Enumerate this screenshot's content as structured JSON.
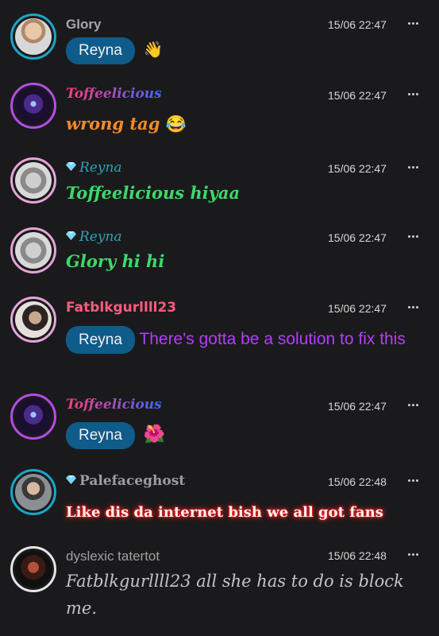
{
  "messages": [
    {
      "author": "Glory",
      "time": "15/06 22:47",
      "mention": "Reyna",
      "text": "",
      "emoji": "👋"
    },
    {
      "author": "Toffeelicious",
      "time": "15/06 22:47",
      "text": "wrong tag",
      "emoji": "😂"
    },
    {
      "author": "Reyna",
      "time": "15/06 22:47",
      "text": "Toffeelicious hiyaa"
    },
    {
      "author": "Reyna",
      "time": "15/06 22:47",
      "text": "Glory hi hi"
    },
    {
      "author": "Fatblkgurllll23",
      "time": "15/06 22:47",
      "mention": "Reyna",
      "text": " There's gotta be a solution to fix this"
    },
    {
      "author": "Toffeelicious",
      "time": "15/06 22:47",
      "mention": "Reyna",
      "emoji": "🌺"
    },
    {
      "author": "Palefaceghost",
      "time": "15/06 22:48",
      "text": "Like dis da internet bish we all got fans"
    },
    {
      "author": "dyslexic tatertot",
      "time": "15/06 22:48",
      "text": "Fatblkgurllll23 all she has to do is block me."
    }
  ],
  "colors": {
    "background": "#1a1a1c",
    "tag": "#0f5b8a",
    "toffee_name_gradient": [
      "#ff3c7a",
      "#3f66ff"
    ],
    "orange_text": "#f28a2a",
    "green_text": "#3ed86a",
    "purple_text": "#b43dff",
    "red_text": "#ff5a5a",
    "gray_text": "#c4c4c4"
  }
}
